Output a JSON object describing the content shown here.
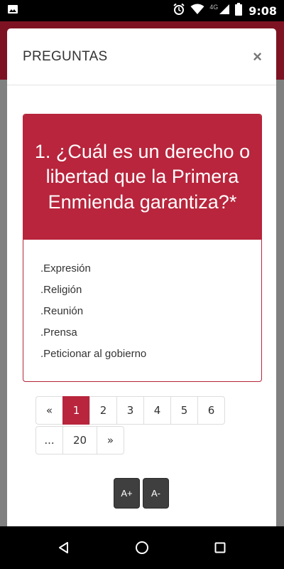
{
  "status_bar": {
    "time": "9:08",
    "network": "4G",
    "icons": [
      "image-icon",
      "alarm-icon",
      "wifi-icon",
      "signal-icon",
      "battery-icon"
    ]
  },
  "modal": {
    "title": "PREGUNTAS",
    "close_label": "×"
  },
  "question": {
    "text": "1. ¿Cuál es un derecho o libertad que la Primera Enmienda garantiza?*",
    "answers": [
      ".Expresión",
      ".Religión",
      ".Reunión",
      ".Prensa",
      ".Peticionar al gobierno"
    ]
  },
  "pagination": {
    "row1": [
      "«",
      "1",
      "2",
      "3",
      "4",
      "5",
      "6"
    ],
    "row2": [
      "...",
      "20",
      "»"
    ],
    "active": "1"
  },
  "font_controls": {
    "increase": "A+",
    "decrease": "A-"
  },
  "colors": {
    "accent": "#b8253c",
    "header_bg": "#7d1322",
    "button_dark": "#3f3f3f"
  }
}
